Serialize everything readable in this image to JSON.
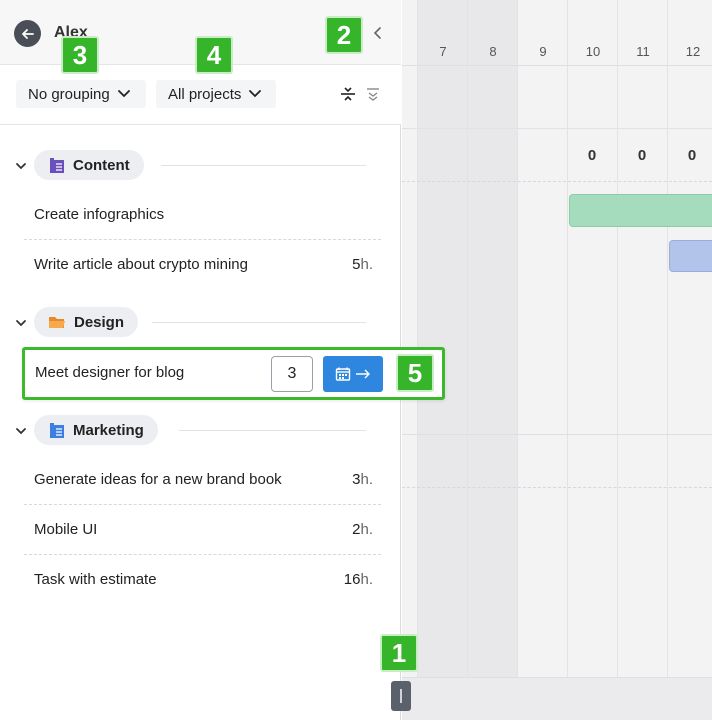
{
  "header": {
    "user_name": "Alex"
  },
  "filters": {
    "grouping": "No grouping",
    "projects": "All projects"
  },
  "groups": [
    {
      "name": "Content",
      "icon": "document-stack-icon",
      "color": "#6b4fbb"
    },
    {
      "name": "Design",
      "icon": "folder-icon",
      "color": "#f39c3d"
    },
    {
      "name": "Marketing",
      "icon": "document-stack-icon",
      "color": "#3b7fe0"
    }
  ],
  "tasks": [
    {
      "name": "Create infographics",
      "hours": "",
      "unit": ""
    },
    {
      "name": "Write article about crypto mining",
      "hours": "5",
      "unit": "h."
    },
    {
      "name": "Meet designer for blog",
      "estimate": "3"
    },
    {
      "name": "Generate ideas for a new brand book",
      "hours": "3",
      "unit": "h."
    },
    {
      "name": "Mobile UI",
      "hours": "2",
      "unit": "h."
    },
    {
      "name": "Task with estimate",
      "hours": "16",
      "unit": "h."
    }
  ],
  "calendar": {
    "days": [
      "7",
      "8",
      "9",
      "10",
      "11",
      "12"
    ],
    "counts": [
      "0",
      "0",
      "0"
    ]
  },
  "badges": [
    "1",
    "2",
    "3",
    "4",
    "5"
  ],
  "colors": {
    "accent": "#2e86de",
    "callout": "#36b52a"
  }
}
